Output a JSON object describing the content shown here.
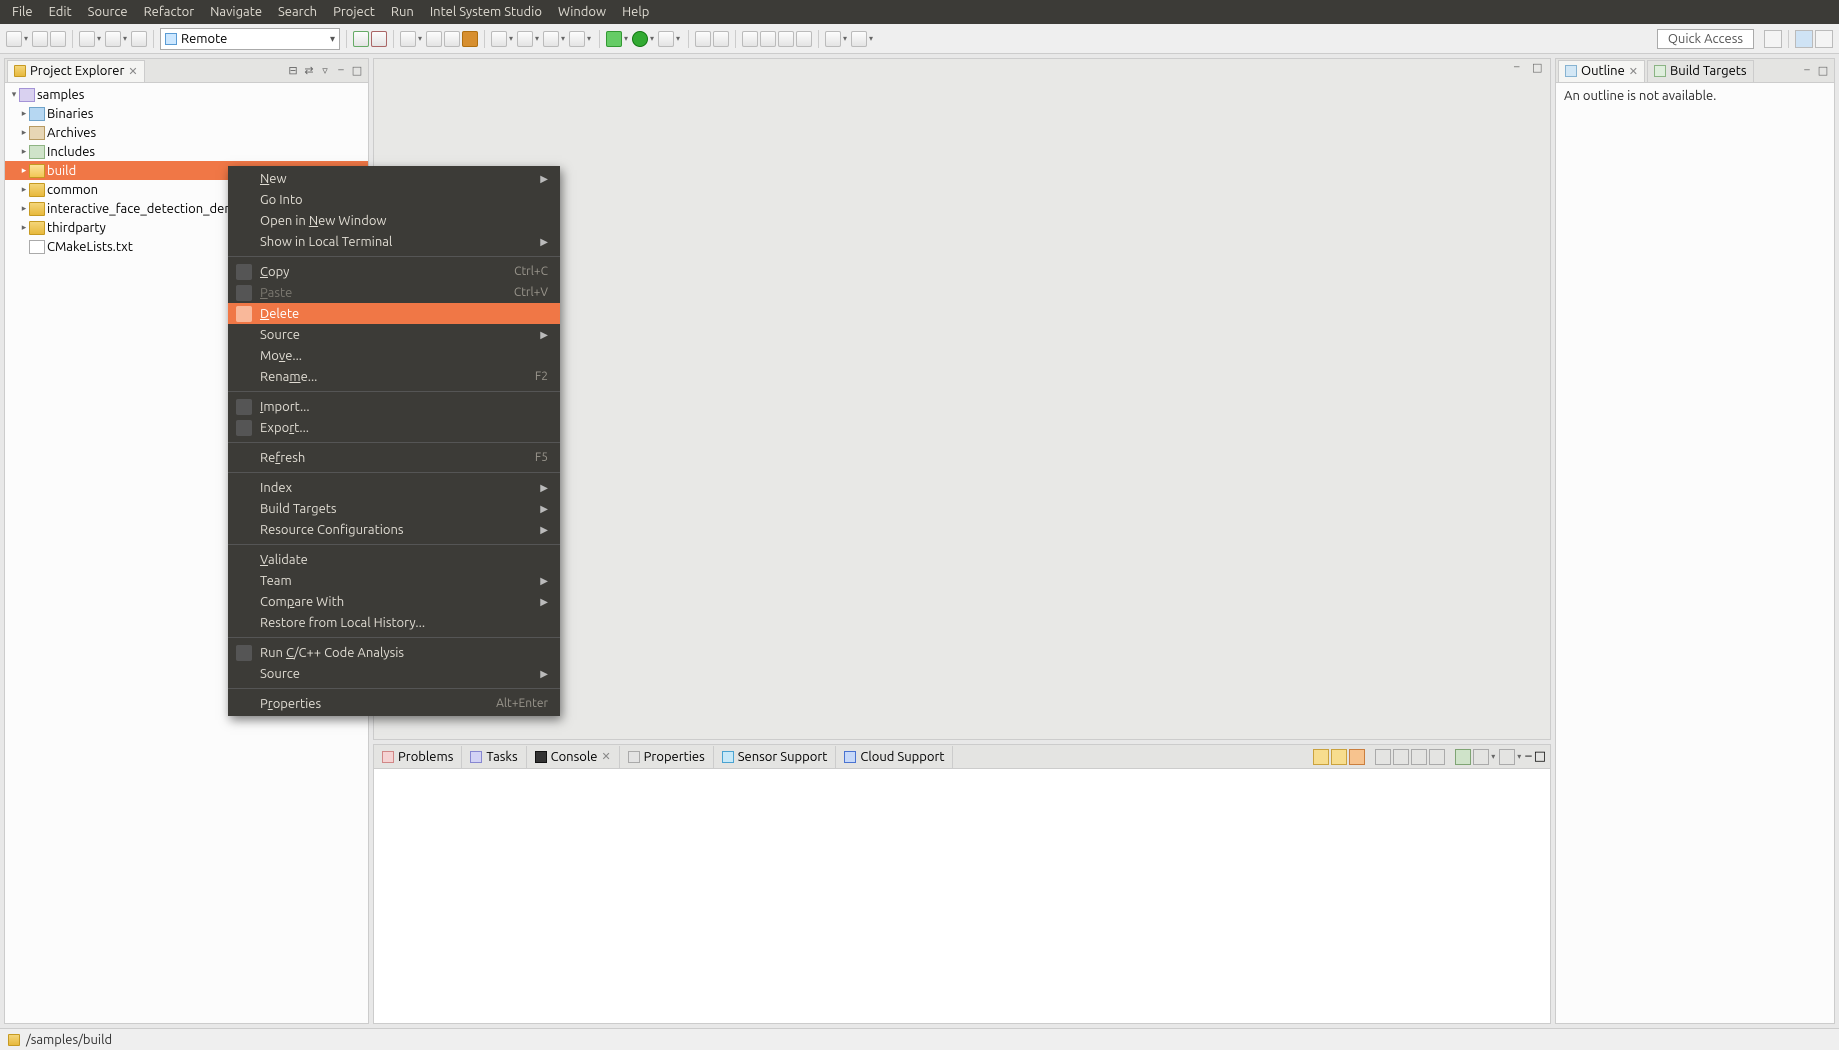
{
  "menubar": [
    "File",
    "Edit",
    "Source",
    "Refactor",
    "Navigate",
    "Search",
    "Project",
    "Run",
    "Intel System Studio",
    "Window",
    "Help"
  ],
  "toolbar": {
    "combo_label": "Remote",
    "quick_access": "Quick Access"
  },
  "left": {
    "tab_title": "Project Explorer",
    "tree": {
      "root": "samples",
      "children": [
        {
          "label": "Binaries",
          "icon": "bin"
        },
        {
          "label": "Archives",
          "icon": "arch"
        },
        {
          "label": "Includes",
          "icon": "inc"
        },
        {
          "label": "build",
          "icon": "folder-open",
          "selected": true
        },
        {
          "label": "common",
          "icon": "folder"
        },
        {
          "label": "interactive_face_detection_demo",
          "icon": "folder"
        },
        {
          "label": "thirdparty",
          "icon": "folder"
        },
        {
          "label": "CMakeLists.txt",
          "icon": "file",
          "leaf": true
        }
      ]
    }
  },
  "right": {
    "tabs": [
      "Outline",
      "Build Targets"
    ],
    "outline_msg": "An outline is not available."
  },
  "bottom": {
    "tabs": [
      "Problems",
      "Tasks",
      "Console",
      "Properties",
      "Sensor Support",
      "Cloud Support"
    ],
    "active": 2
  },
  "status": {
    "path": "/samples/build"
  },
  "context_menu": [
    {
      "label": "New",
      "underline": 0,
      "submenu": true
    },
    {
      "label": "Go Into"
    },
    {
      "label": "Open in New Window",
      "underline": 8
    },
    {
      "label": "Show in Local Terminal",
      "submenu": true
    },
    {
      "sep": true
    },
    {
      "label": "Copy",
      "icon": "copy",
      "accel": "Ctrl+C",
      "underline": 0
    },
    {
      "label": "Paste",
      "icon": "paste",
      "accel": "Ctrl+V",
      "underline": 0,
      "disabled": true
    },
    {
      "label": "Delete",
      "icon": "delete",
      "underline": 0,
      "highlight": true
    },
    {
      "label": "Source",
      "submenu": true
    },
    {
      "label": "Move...",
      "underline": 2
    },
    {
      "label": "Rename...",
      "accel": "F2",
      "underline": 4
    },
    {
      "sep": true
    },
    {
      "label": "Import...",
      "icon": "import",
      "underline": 0
    },
    {
      "label": "Export...",
      "icon": "export",
      "underline": 4
    },
    {
      "sep": true
    },
    {
      "label": "Refresh",
      "accel": "F5",
      "underline": 2
    },
    {
      "sep": true
    },
    {
      "label": "Index",
      "submenu": true
    },
    {
      "label": "Build Targets",
      "submenu": true
    },
    {
      "label": "Resource Configurations",
      "submenu": true
    },
    {
      "sep": true
    },
    {
      "label": "Validate",
      "underline": 0
    },
    {
      "label": "Team",
      "submenu": true
    },
    {
      "label": "Compare With",
      "submenu": true,
      "underline": 3
    },
    {
      "label": "Restore from Local History..."
    },
    {
      "sep": true
    },
    {
      "label": "Run C/C++ Code Analysis",
      "icon": "analysis",
      "underline": 4
    },
    {
      "label": "Source",
      "submenu": true
    },
    {
      "sep": true
    },
    {
      "label": "Properties",
      "accel": "Alt+Enter",
      "underline": 1
    }
  ]
}
